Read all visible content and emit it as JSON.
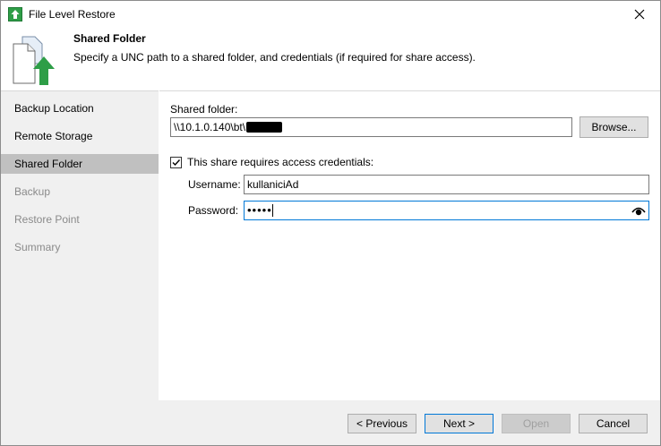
{
  "window": {
    "title": "File Level Restore"
  },
  "header": {
    "title": "Shared Folder",
    "description": "Specify a UNC path to a shared folder, and credentials (if required for share access)."
  },
  "nav": {
    "items": [
      {
        "label": "Backup Location",
        "state": "normal"
      },
      {
        "label": "Remote Storage",
        "state": "normal"
      },
      {
        "label": "Shared Folder",
        "state": "active"
      },
      {
        "label": "Backup",
        "state": "disabled"
      },
      {
        "label": "Restore Point",
        "state": "disabled"
      },
      {
        "label": "Summary",
        "state": "disabled"
      }
    ]
  },
  "form": {
    "shared_folder_label": "Shared folder:",
    "shared_folder_value": "\\\\10.1.0.140\\bt\\",
    "browse_label": "Browse...",
    "credentials_checkbox_label": "This share requires access credentials:",
    "credentials_checked": true,
    "username_label": "Username:",
    "username_value": "kullaniciAd",
    "password_label": "Password:",
    "password_value": "•••••"
  },
  "footer": {
    "previous_label": "< Previous",
    "next_label": "Next >",
    "open_label": "Open",
    "cancel_label": "Cancel"
  },
  "colors": {
    "accent": "#0078d7",
    "app_icon": "#2e9e47",
    "sidebar_bg": "#f0f0f0",
    "selected_nav": "#c0c0c0"
  },
  "icons": {
    "app": "restore-arrow-icon",
    "header": "document-upload-icon",
    "close": "close-icon",
    "reveal": "eye-icon",
    "check": "checkmark-icon"
  }
}
